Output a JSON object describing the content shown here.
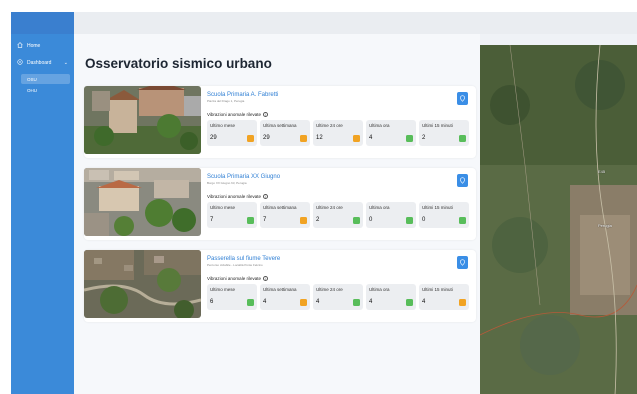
{
  "sidebar": {
    "items": [
      {
        "label": "Home",
        "icon": "home-icon"
      },
      {
        "label": "Dashboard",
        "icon": "dashboard-icon",
        "chevron": "⌄"
      }
    ],
    "subitems": [
      {
        "label": "OSU",
        "active": true
      },
      {
        "label": "OHU",
        "active": false
      }
    ]
  },
  "main": {
    "title": "Osservatorio sismico urbano",
    "sites": [
      {
        "name": "Scuola Primaria A. Fabretti",
        "address": "Piazza del Drago 1, Perugia",
        "anomalies_label": "Vibrazioni anomale rilevate",
        "info_glyph": "i",
        "stats": [
          {
            "label": "Ultimo mese",
            "value": "29",
            "status": "orange"
          },
          {
            "label": "Ultima settimana",
            "value": "29",
            "status": "orange"
          },
          {
            "label": "Ultime 24 ore",
            "value": "12",
            "status": "orange"
          },
          {
            "label": "Ultima ora",
            "value": "4",
            "status": "green"
          },
          {
            "label": "Ultimi 15 minuti",
            "value": "2",
            "status": "green"
          }
        ]
      },
      {
        "name": "Scuola Primaria XX Giugno",
        "address": "Borgo XX Giugno 63, Perugia",
        "anomalies_label": "Vibrazioni anomale rilevate",
        "info_glyph": "i",
        "stats": [
          {
            "label": "Ultimo mese",
            "value": "7",
            "status": "green"
          },
          {
            "label": "Ultima settimana",
            "value": "7",
            "status": "orange"
          },
          {
            "label": "Ultime 24 ore",
            "value": "2",
            "status": "green"
          },
          {
            "label": "Ultima ora",
            "value": "0",
            "status": "green"
          },
          {
            "label": "Ultimi 15 minuti",
            "value": "0",
            "status": "green"
          }
        ]
      },
      {
        "name": "Passerella sul fiume Tevere",
        "address": "Percorso ciclabile - Località Ponte Felcino",
        "anomalies_label": "Vibrazioni anomale rilevate",
        "info_glyph": "i",
        "stats": [
          {
            "label": "Ultimo mese",
            "value": "6",
            "status": "green"
          },
          {
            "label": "Ultima settimana",
            "value": "4",
            "status": "orange"
          },
          {
            "label": "Ultime 24 ore",
            "value": "4",
            "status": "green"
          },
          {
            "label": "Ultima ora",
            "value": "4",
            "status": "green"
          },
          {
            "label": "Ultimi 15 minuti",
            "value": "4",
            "status": "orange"
          }
        ]
      }
    ]
  },
  "map": {
    "labels": [
      "E45",
      "Perugia"
    ]
  },
  "colors": {
    "sidebar": "#3b8ad9",
    "accent": "#2f7fd4",
    "orange": "#f1a323",
    "green": "#58bd5a"
  }
}
